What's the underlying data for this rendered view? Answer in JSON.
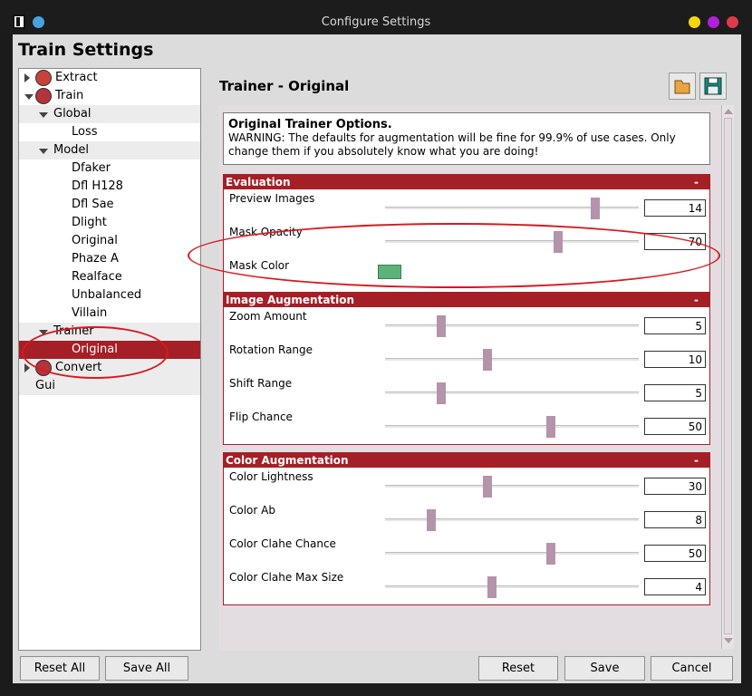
{
  "window": {
    "title": "Configure Settings"
  },
  "heading": "Train Settings",
  "tree": [
    {
      "label": "Extract",
      "level": 0,
      "toggle": "right",
      "icon": "extract-icon",
      "shade": false
    },
    {
      "label": "Train",
      "level": 0,
      "toggle": "down",
      "icon": "train-icon",
      "shade": false
    },
    {
      "label": "Global",
      "level": 1,
      "toggle": "down",
      "shade": true
    },
    {
      "label": "Loss",
      "level": 2,
      "shade": false
    },
    {
      "label": "Model",
      "level": 1,
      "toggle": "down",
      "shade": true
    },
    {
      "label": "Dfaker",
      "level": 2,
      "shade": false
    },
    {
      "label": "Dfl H128",
      "level": 2,
      "shade": false
    },
    {
      "label": "Dfl Sae",
      "level": 2,
      "shade": false
    },
    {
      "label": "Dlight",
      "level": 2,
      "shade": false
    },
    {
      "label": "Original",
      "level": 2,
      "shade": false
    },
    {
      "label": "Phaze A",
      "level": 2,
      "shade": false
    },
    {
      "label": "Realface",
      "level": 2,
      "shade": false
    },
    {
      "label": "Unbalanced",
      "level": 2,
      "shade": false
    },
    {
      "label": "Villain",
      "level": 2,
      "shade": false
    },
    {
      "label": "Trainer",
      "level": 1,
      "toggle": "down",
      "shade": true
    },
    {
      "label": "Original",
      "level": 2,
      "selected": true
    },
    {
      "label": "Convert",
      "level": 0,
      "toggle": "right",
      "icon": "convert-icon",
      "shade": true
    },
    {
      "label": "Gui",
      "level": 0,
      "shade": true
    }
  ],
  "pane": {
    "title": "Trainer - Original",
    "info_title": "Original Trainer Options.",
    "info_text": "WARNING: The defaults for augmentation will be fine for 99.9% of use cases. Only change them if you absolutely know what you are doing!"
  },
  "groups": [
    {
      "title": "Evaluation",
      "collapse": "-",
      "options": [
        {
          "label": "Preview Images",
          "value": "14",
          "fraction": 0.84
        },
        {
          "label": "Mask Opacity",
          "value": "70",
          "fraction": 0.69
        },
        {
          "label": "Mask Color",
          "type": "color",
          "color": "#5cb37a"
        }
      ]
    },
    {
      "title": "Image Augmentation",
      "collapse": "-",
      "options": [
        {
          "label": "Zoom Amount",
          "value": "5",
          "fraction": 0.21
        },
        {
          "label": "Rotation Range",
          "value": "10",
          "fraction": 0.4
        },
        {
          "label": "Shift Range",
          "value": "5",
          "fraction": 0.21
        },
        {
          "label": "Flip Chance",
          "value": "50",
          "fraction": 0.66
        }
      ]
    },
    {
      "title": "Color Augmentation",
      "collapse": "-",
      "options": [
        {
          "label": "Color Lightness",
          "value": "30",
          "fraction": 0.4
        },
        {
          "label": "Color Ab",
          "value": "8",
          "fraction": 0.17
        },
        {
          "label": "Color Clahe Chance",
          "value": "50",
          "fraction": 0.66
        },
        {
          "label": "Color Clahe Max Size",
          "value": "4",
          "fraction": 0.42
        }
      ]
    }
  ],
  "buttons": {
    "reset_all": "Reset All",
    "save_all": "Save All",
    "reset": "Reset",
    "save": "Save",
    "cancel": "Cancel"
  },
  "colors": {
    "accent": "#a51f26",
    "slider_thumb": "#b493ab",
    "annotation": "#d71920",
    "dot_blue": "#4aa3df",
    "dot_yellow": "#f5d60a",
    "dot_purple": "#b11fd8",
    "dot_red": "#e03a4a"
  }
}
